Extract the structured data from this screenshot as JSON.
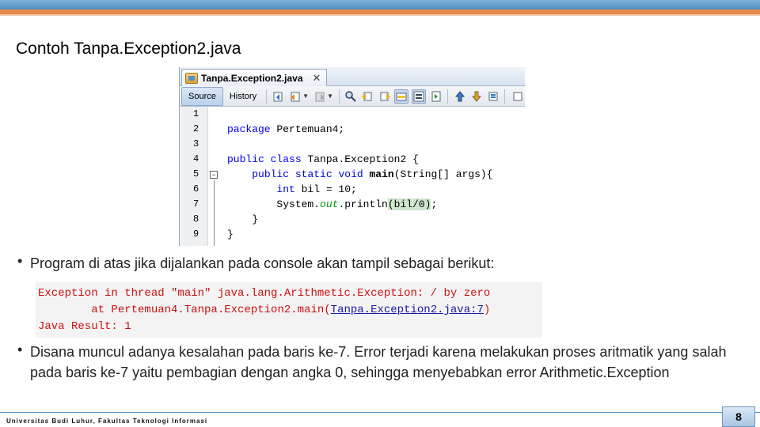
{
  "slide": {
    "title": "Contoh Tanpa.Exception2.java",
    "footer": "Universitas Budi Luhur, Fakultas Teknologi Informasi",
    "page_number": "8"
  },
  "ide": {
    "file_tab": {
      "label": "Tanpa.Exception2.java",
      "close": "✕"
    },
    "view_tabs": [
      {
        "label": "Source",
        "active": true
      },
      {
        "label": "History",
        "active": false
      }
    ],
    "line_numbers": [
      "1",
      "2",
      "3",
      "4",
      "5",
      "6",
      "7",
      "8",
      "9"
    ],
    "code": {
      "l2_kw": "package",
      "l2_rest": " Pertemuan4;",
      "l4_kw1": "public",
      "l4_kw2": "class",
      "l4_rest": " Tanpa.Exception2 {",
      "l5_indent": "    ",
      "l5_kw1": "public",
      "l5_kw2": "static",
      "l5_kw3": "void",
      "l5_method": "main",
      "l5_rest": "(String[] args){",
      "l6_indent": "        ",
      "l6_kw": "int",
      "l6_rest": " bil = 10;",
      "l7_indent": "        ",
      "l7_a": "System.",
      "l7_field": "out",
      "l7_b": ".println",
      "l7_c": "(bil/0)",
      "l7_d": ";",
      "l8": "    }",
      "l9": "}"
    }
  },
  "bullets": {
    "b1": "Program di atas jika dijalankan pada console akan tampil sebagai berikut:",
    "b2": "Disana muncul adanya kesalahan pada baris ke-7. Error terjadi karena melakukan proses aritmatik yang salah pada baris ke-7 yaitu pembagian dengan angka 0, sehingga menyebabkan error Arithmetic.Exception"
  },
  "console": {
    "line1": "Exception in thread \"main\" java.lang.Arithmetic.Exception: / by zero",
    "line2_prefix": "        at Pertemuan4.Tanpa.Exception2.main(",
    "line2_link": "Tanpa.Exception2.java:7",
    "line2_suffix": ")",
    "line3": "Java Result: 1"
  },
  "bullet_glyph": "•"
}
